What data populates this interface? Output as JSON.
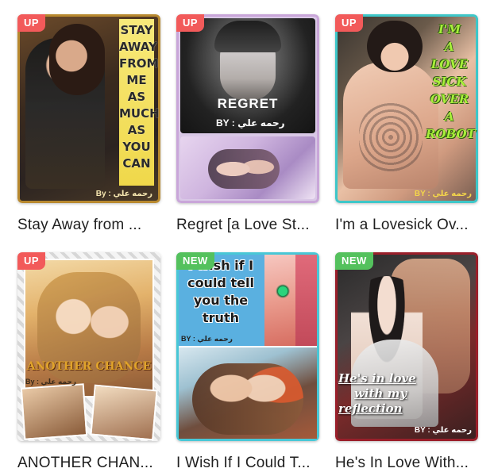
{
  "colors": {
    "badge_up": "#f25a5a",
    "badge_new": "#54c15d",
    "title_text": "#1f1f1f"
  },
  "books": [
    {
      "badge": "UP",
      "badge_type": "up",
      "title": "Stay Away from ...",
      "cover_text": [
        "STAY",
        "AWAY",
        "FROM",
        "ME",
        "AS",
        "MUCH",
        "AS",
        "YOU",
        "CAN"
      ],
      "cover_byline": "By : رحمه علي"
    },
    {
      "badge": "UP",
      "badge_type": "up",
      "title": "Regret [a Love St...",
      "cover_text": [
        "REGRET"
      ],
      "cover_byline": "BY : رحمه علي"
    },
    {
      "badge": "UP",
      "badge_type": "up",
      "title": "I'm a Lovesick Ov...",
      "cover_text": [
        "I'M",
        "A",
        "LOVE",
        "SICK",
        "OVER",
        "A",
        "ROBOT"
      ],
      "cover_byline": "BY : رحمه علي"
    },
    {
      "badge": "UP",
      "badge_type": "up",
      "title": "ANOTHER CHAN...",
      "cover_text": [
        "ANOTHER CHANCE"
      ],
      "cover_byline": "By : رحمه علي"
    },
    {
      "badge": "NEW",
      "badge_type": "new",
      "title": "I Wish If I Could T...",
      "cover_text": [
        "I wish if I",
        "could tell",
        "you the",
        "truth"
      ],
      "cover_byline": "BY : رحمه علي"
    },
    {
      "badge": "NEW",
      "badge_type": "new",
      "title": "He's In Love With...",
      "cover_text": [
        "He's in love",
        "with my",
        "reflection"
      ],
      "cover_byline": "BY : رحمه علي"
    }
  ]
}
